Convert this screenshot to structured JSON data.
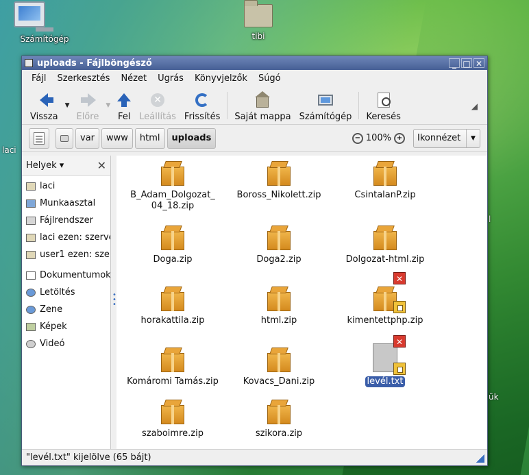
{
  "desktop": {
    "icons": [
      {
        "label": "Számítógép"
      },
      {
        "label": "tibi"
      }
    ],
    "edge_labels": [
      "laci",
      "l",
      "ük"
    ]
  },
  "window": {
    "title": "uploads - Fájlböngésző",
    "menu": [
      "Fájl",
      "Szerkesztés",
      "Nézet",
      "Ugrás",
      "Könyvjelzők",
      "Súgó"
    ],
    "toolbar": {
      "back": "Vissza",
      "forward": "Előre",
      "up": "Fel",
      "stop": "Leállítás",
      "reload": "Frissítés",
      "home": "Saját mappa",
      "computer": "Számítógép",
      "search": "Keresés"
    },
    "location": {
      "crumbs": [
        "var",
        "www",
        "html",
        "uploads"
      ],
      "active": "uploads",
      "zoom": "100%",
      "view": "Ikonnézet"
    },
    "sidebar": {
      "title": "Helyek",
      "items": [
        "laci",
        "Munkaasztal",
        "Fájlrendszer",
        "laci ezen: szerve",
        "user1 ezen: sze",
        "Dokumentumok",
        "Letöltés",
        "Zene",
        "Képek",
        "Videó"
      ]
    },
    "files": [
      {
        "name": "B_Adam_Dolgozat_",
        "name2": "04_18.zip"
      },
      {
        "name": "Boross_Nikolett.zip"
      },
      {
        "name": "CsintalanP.zip"
      },
      {
        "name": "Doga.zip"
      },
      {
        "name": "Doga2.zip"
      },
      {
        "name": "Dolgozat-html.zip"
      },
      {
        "name": "horakattila.zip"
      },
      {
        "name": "html.zip"
      },
      {
        "name": "kimentettphp.zip"
      },
      {
        "name": "Komáromi Tamás.zip"
      },
      {
        "name": "Kovacs_Dani.zip"
      },
      {
        "name": "levél.txt",
        "selected": true
      },
      {
        "name": "szaboimre.zip"
      },
      {
        "name": "szikora.zip"
      }
    ],
    "status": "\"levél.txt\" kijelölve (65 bájt)"
  },
  "colors": {
    "titlebar": "#465f95",
    "selection": "#3b5ea9",
    "package": "#e9a53a"
  }
}
